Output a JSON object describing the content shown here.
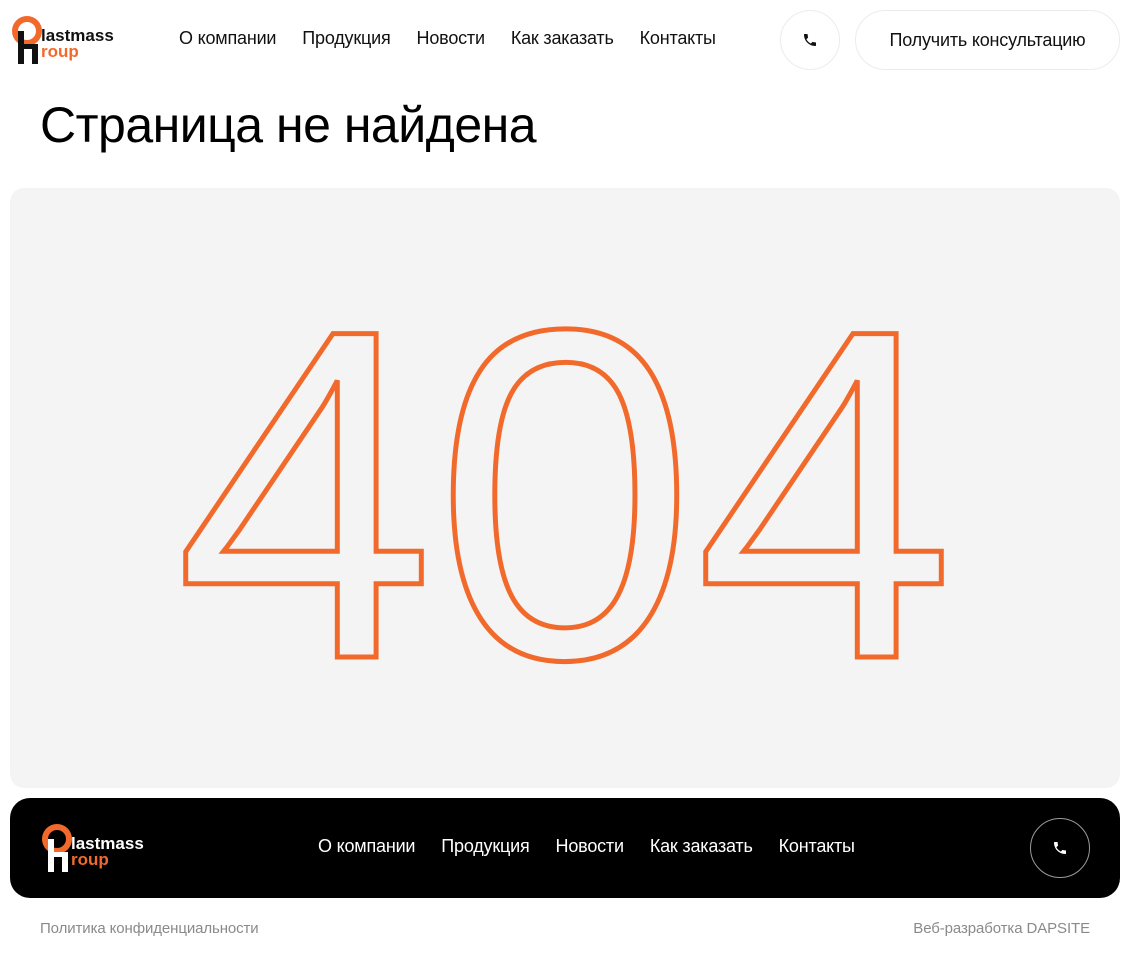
{
  "brand": {
    "logo_text_top": "lastmass",
    "logo_text_bottom": "roup",
    "accent_color": "#f26a2b",
    "logo_dark_color": "#111111"
  },
  "header": {
    "nav": [
      "О компании",
      "Продукция",
      "Новости",
      "Как заказать",
      "Контакты"
    ],
    "phone_icon": "phone-icon",
    "consult_label": "Получить консультацию"
  },
  "main": {
    "title": "Страница не найдена",
    "error_code": "404",
    "panel_color": "#f4f4f4"
  },
  "footer": {
    "nav": [
      "О компании",
      "Продукция",
      "Новости",
      "Как заказать",
      "Контакты"
    ],
    "phone_icon": "phone-icon",
    "privacy_label": "Политика конфиденциальности",
    "developer_label": "Веб-разработка DAPSITE"
  }
}
